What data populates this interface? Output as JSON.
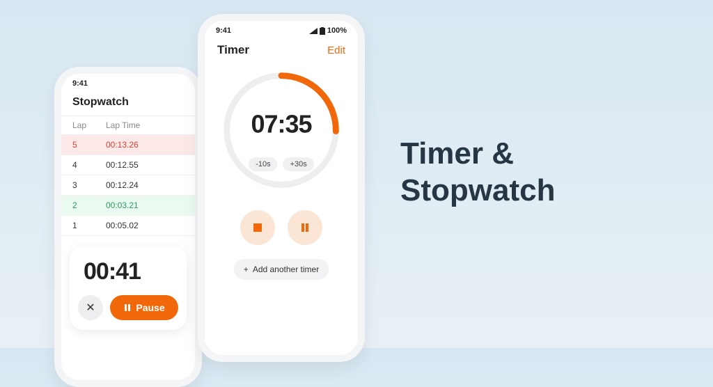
{
  "hero": {
    "line1": "Timer &",
    "line2": "Stopwatch"
  },
  "status": {
    "time": "9:41",
    "battery": "100%"
  },
  "timer": {
    "title": "Timer",
    "edit": "Edit",
    "time": "07:35",
    "minus": "-10s",
    "plus": "+30s",
    "add_another": "Add another timer"
  },
  "stopwatch": {
    "title": "Stopwatch",
    "col_lap": "Lap",
    "col_time": "Lap Time",
    "rows": [
      {
        "n": "5",
        "t": "00:13.26",
        "cls": "r-red"
      },
      {
        "n": "4",
        "t": "00:12.55",
        "cls": ""
      },
      {
        "n": "3",
        "t": "00:12.24",
        "cls": ""
      },
      {
        "n": "2",
        "t": "00:03.21",
        "cls": "r-green"
      },
      {
        "n": "1",
        "t": "00:05.02",
        "cls": ""
      }
    ],
    "elapsed": "00:41",
    "pause": "Pause"
  },
  "colors": {
    "accent": "#f1680a"
  }
}
